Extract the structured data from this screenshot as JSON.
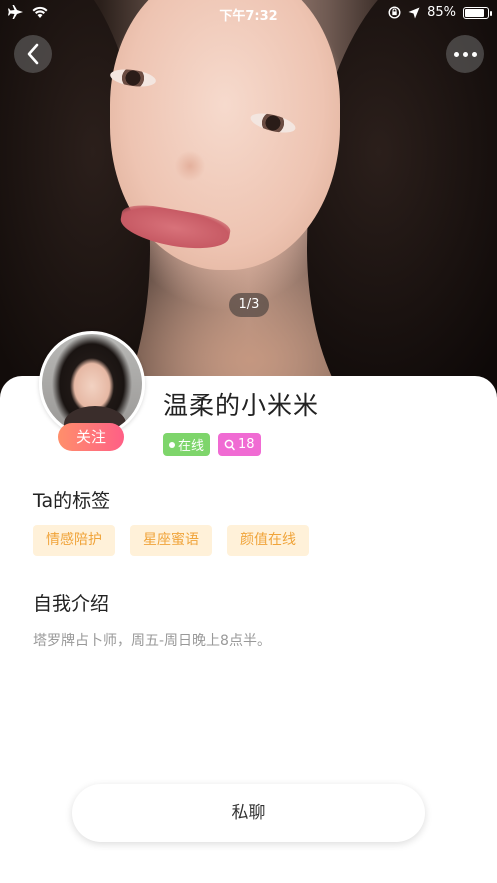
{
  "status_bar": {
    "time": "下午7:32",
    "battery_text": "85%",
    "battery_level": 0.85
  },
  "photo": {
    "page_indicator": "1/3"
  },
  "profile": {
    "follow_label": "关注",
    "username": "温柔的小米米",
    "online_label": "在线",
    "age": "18"
  },
  "tags_section": {
    "title": "Ta的标签",
    "tags": [
      "情感陪护",
      "星座蜜语",
      "颜值在线"
    ]
  },
  "intro_section": {
    "title": "自我介绍",
    "text": "塔罗牌占卜师，周五-周日晚上8点半。"
  },
  "actions": {
    "chat_label": "私聊"
  },
  "colors": {
    "follow_gradient_start": "#ff8f6b",
    "follow_gradient_end": "#ff5f86",
    "online_badge": "#7ed56b",
    "age_badge": "#f06bd3",
    "tag_bg": "#fff1d9",
    "tag_text": "#f0a43a"
  }
}
